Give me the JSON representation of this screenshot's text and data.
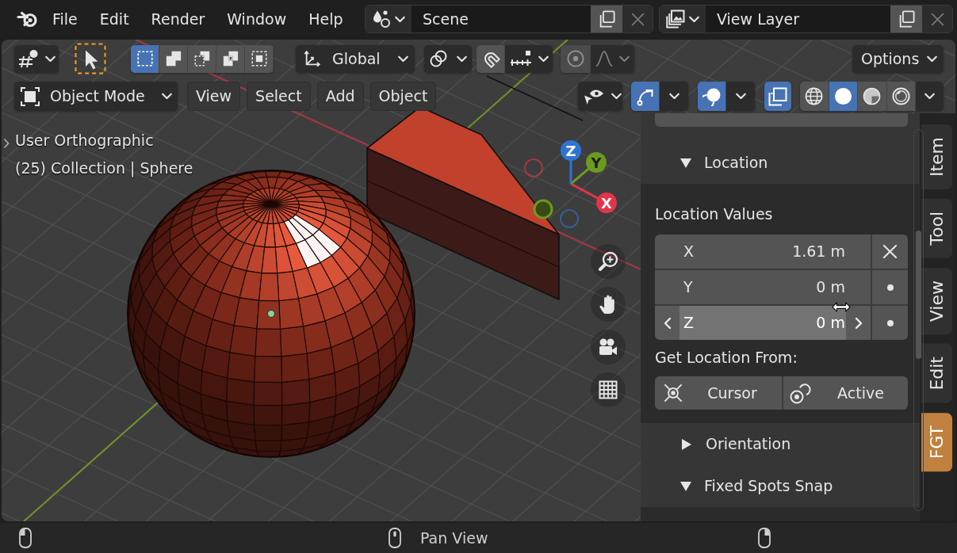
{
  "top_bar": {
    "menus": [
      {
        "label": "File"
      },
      {
        "label": "Edit"
      },
      {
        "label": "Render"
      },
      {
        "label": "Window"
      },
      {
        "label": "Help"
      }
    ],
    "scene": {
      "value": "Scene"
    },
    "view_layer": {
      "value": "View Layer"
    }
  },
  "tool_header": {
    "select_modes": [
      {
        "kind": "set",
        "selected": true
      },
      {
        "kind": "extend",
        "selected": false
      },
      {
        "kind": "subtract",
        "selected": false
      },
      {
        "kind": "invert",
        "selected": false
      },
      {
        "kind": "intersect",
        "selected": false
      }
    ],
    "orientation": "Global",
    "snapping": {
      "on": false
    },
    "proportional_editing": {
      "on": false,
      "disabled": true
    },
    "options": "Options"
  },
  "viewport_header": {
    "mode": "Object Mode",
    "menus": [
      {
        "label": "View"
      },
      {
        "label": "Select"
      },
      {
        "label": "Add"
      },
      {
        "label": "Object"
      }
    ],
    "gizmos": {
      "on": true
    },
    "overlays": {
      "on": true
    },
    "xray": {
      "on": true
    },
    "shading_modes": [
      {
        "kind": "wireframe",
        "selected": false
      },
      {
        "kind": "solid",
        "selected": true
      },
      {
        "kind": "material",
        "selected": false
      },
      {
        "kind": "rendered",
        "selected": false
      }
    ]
  },
  "viewport": {
    "view_name": "User Orthographic",
    "scene_info": "(25) Collection | Sphere",
    "gizmo_axes": [
      {
        "label": "X",
        "color": "#e0354a"
      },
      {
        "label": "Y",
        "color": "#6c9a1e"
      },
      {
        "label": "Z",
        "color": "#2f74d0"
      }
    ]
  },
  "sidebar": {
    "panels": [
      {
        "title": "Location",
        "expanded": true,
        "values_label": "Location Values",
        "fields": [
          {
            "label": "X",
            "value": "1.61 m",
            "hovered": false,
            "side_button": {
              "kind": "clear"
            }
          },
          {
            "label": "Y",
            "value": "0 m",
            "hovered": false,
            "side_button": {
              "kind": "dot"
            }
          },
          {
            "label": "Z",
            "value": "0 m",
            "hovered": true,
            "side_button": {
              "kind": "dot"
            }
          }
        ],
        "source_label": "Get Location From:",
        "source_buttons": [
          {
            "kind": "cursor",
            "label": "Cursor"
          },
          {
            "kind": "active",
            "label": "Active"
          }
        ]
      },
      {
        "title": "Orientation",
        "expanded": false
      },
      {
        "title": "Fixed Spots Snap",
        "expanded": true
      }
    ],
    "tabs": [
      {
        "label": "Item",
        "selected": false
      },
      {
        "label": "Tool",
        "selected": false
      },
      {
        "label": "View",
        "selected": false
      },
      {
        "label": "Edit",
        "selected": false
      },
      {
        "label": "FGT",
        "selected": true
      }
    ]
  },
  "status_bar": {
    "hints": [
      {
        "kind": "left_mouse"
      },
      {
        "kind": "middle_mouse",
        "text": "Pan View"
      },
      {
        "kind": "right_mouse"
      }
    ]
  }
}
